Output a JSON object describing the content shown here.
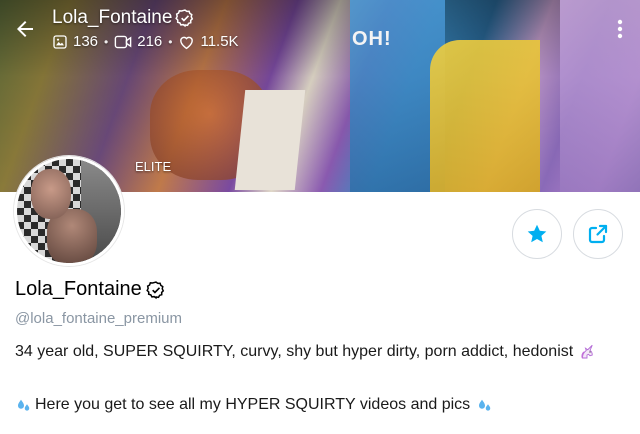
{
  "header": {
    "title": "Lola_Fontaine",
    "stats": {
      "photos": "136",
      "videos": "216",
      "likes": "11.5K"
    },
    "cover_sign": "OH!",
    "badge": "ELITE"
  },
  "profile": {
    "name": "Lola_Fontaine",
    "handle": "@lola_fontaine_premium",
    "bio_line1": "34 year old, SUPER SQUIRTY, curvy, shy but hyper dirty, porn addict, hedonist",
    "bio_line2": "Here you get to see all my HYPER SQUIRTY videos and pics"
  },
  "icons": {
    "back": "arrow-left-icon",
    "more": "more-vertical-icon",
    "verified": "verified-badge-icon",
    "photos": "image-icon",
    "videos": "video-icon",
    "likes": "heart-icon",
    "favorite": "star-icon",
    "share": "share-icon",
    "unicorn": "unicorn-emoji",
    "droplets": "sweat-droplets-emoji"
  },
  "colors": {
    "accent": "#00aff0",
    "muted": "#8a96a3",
    "border": "#d7dbe0"
  }
}
